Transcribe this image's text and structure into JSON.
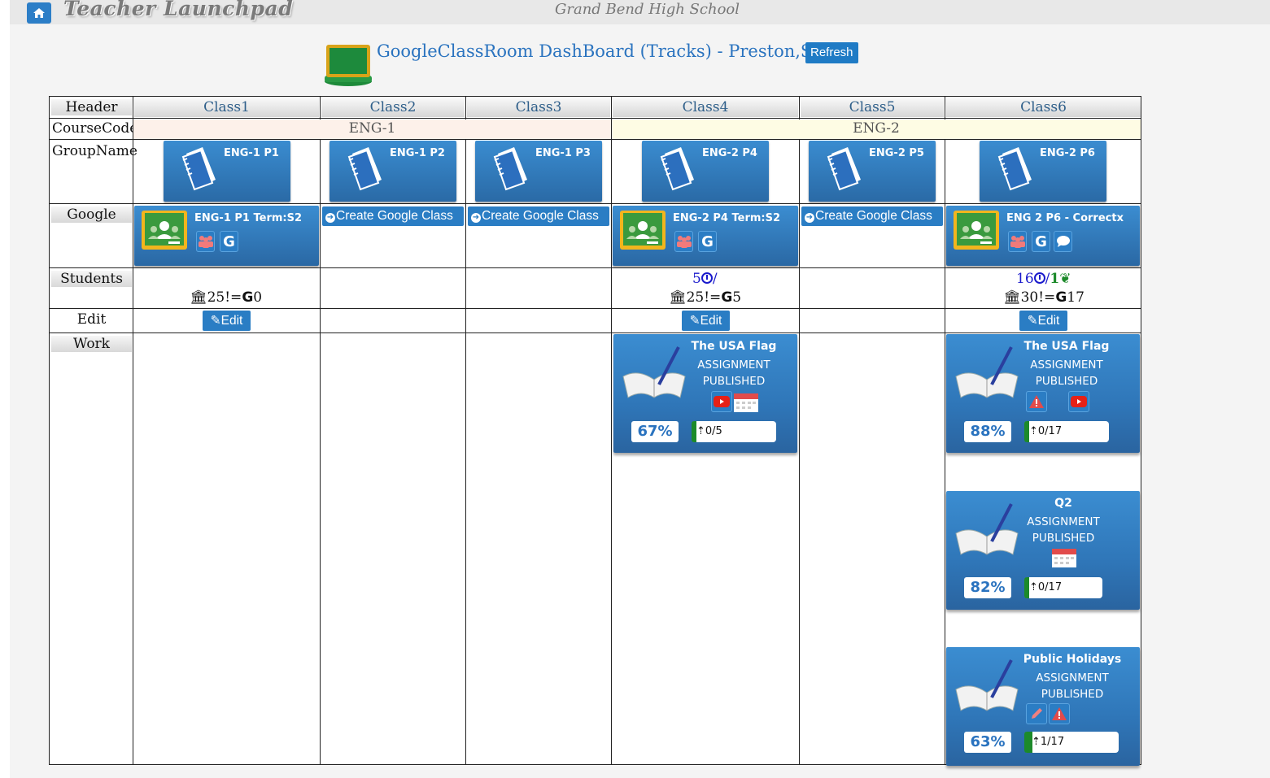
{
  "app": {
    "title": "Teacher Launchpad",
    "school": "Grand Bend High School"
  },
  "dashboard": {
    "title": "GoogleClassRoom DashBoard (Tracks) - Preston,Sara",
    "refresh_label": "Refresh"
  },
  "row_labels": {
    "header": "Header",
    "course_code": "CourseCode",
    "group_name": "GroupName",
    "google": "Google",
    "students": "Students",
    "edit": "Edit",
    "work": "Work"
  },
  "classes": [
    {
      "header": "Class1",
      "group": "ENG-1 P1",
      "google": "ENG-1 P1 Term:S2",
      "students_bottom": "25!=",
      "students_g": "0",
      "edit": "Edit"
    },
    {
      "header": "Class2",
      "group": "ENG-1 P2",
      "google_create": "Create Google Class"
    },
    {
      "header": "Class3",
      "group": "ENG-1 P3",
      "google_create": "Create Google Class"
    },
    {
      "header": "Class4",
      "group": "ENG-2 P4",
      "google": "ENG-2 P4 Term:S2",
      "students_top": "5",
      "students_top_sep": "/",
      "students_bottom": "25!=",
      "students_g": "5",
      "edit": "Edit"
    },
    {
      "header": "Class5",
      "group": "ENG-2 P5",
      "google_create": "Create Google Class"
    },
    {
      "header": "Class6",
      "group": "ENG-2 P6",
      "google": "ENG 2 P6 - Correctx",
      "students_top": "16",
      "students_top_sep": "/",
      "students_top_extra": "1",
      "students_bottom": "30!=",
      "students_g": "17",
      "edit": "Edit"
    }
  ],
  "course_codes": [
    "ENG-1",
    "ENG-2"
  ],
  "work": {
    "class4": [
      {
        "title": "The USA Flag",
        "type": "ASSIGNMENT",
        "state": "PUBLISHED",
        "percent": "67%",
        "progress": "0/5",
        "progress_fraction": 0.0,
        "icons": [
          "youtube-icon",
          "calendar-icon"
        ]
      }
    ],
    "class6": [
      {
        "title": "The USA Flag",
        "type": "ASSIGNMENT",
        "state": "PUBLISHED",
        "percent": "88%",
        "progress": "0/17",
        "progress_fraction": 0.0,
        "icons": [
          "warning-icon",
          "youtube-icon"
        ]
      },
      {
        "title": "Q2",
        "type": "ASSIGNMENT",
        "state": "PUBLISHED",
        "percent": "82%",
        "progress": "0/17",
        "progress_fraction": 0.0,
        "icons": [
          "calendar-icon"
        ]
      },
      {
        "title": "Public Holidays",
        "type": "ASSIGNMENT",
        "state": "PUBLISHED",
        "percent": "63%",
        "progress": "1/17",
        "progress_fraction": 0.06,
        "icons": [
          "pencil-icon",
          "warning-icon"
        ]
      }
    ]
  },
  "colors": {
    "accent": "#2a7dc4",
    "title_blue": "#2a73bf",
    "course1_band": "#fdf1ea",
    "course2_band": "#fefce4",
    "progress_green": "#1c8a2a"
  }
}
